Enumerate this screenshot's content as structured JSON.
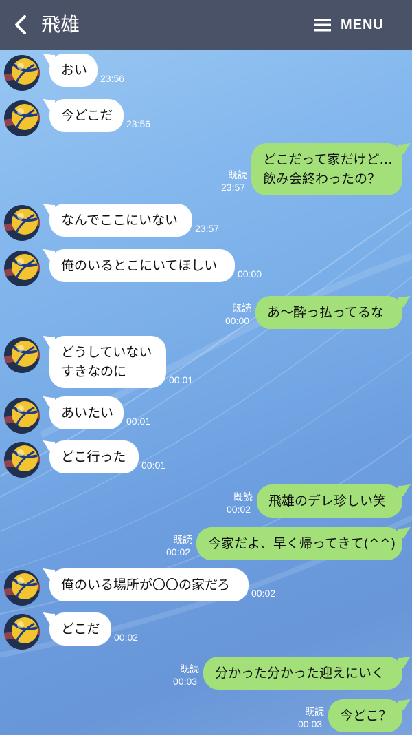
{
  "header": {
    "title": "飛雄",
    "menu_label": "MENU"
  },
  "messages": [
    {
      "side": "in",
      "lines": [
        "おい"
      ],
      "time": "23:56"
    },
    {
      "side": "in",
      "lines": [
        "今どこだ"
      ],
      "time": "23:56"
    },
    {
      "side": "out",
      "lines": [
        "どこだって家だけど…",
        "飲み会終わったの？"
      ],
      "time": "23:57",
      "read": "既読"
    },
    {
      "side": "in",
      "lines": [
        "なんでここにいない"
      ],
      "time": "23:57"
    },
    {
      "side": "in",
      "lines": [
        "俺のいるとこにいてほしい"
      ],
      "time": "00:00"
    },
    {
      "side": "out",
      "lines": [
        "あ〜酔っ払ってるな"
      ],
      "time": "00:00",
      "read": "既読"
    },
    {
      "side": "in",
      "lines": [
        "どうしていない",
        "すきなのに"
      ],
      "time": "00:01"
    },
    {
      "side": "in",
      "lines": [
        "あいたい"
      ],
      "time": "00:01"
    },
    {
      "side": "in",
      "lines": [
        "どこ行った"
      ],
      "time": "00:01"
    },
    {
      "side": "out",
      "lines": [
        "飛雄のデレ珍しい笑"
      ],
      "time": "00:02",
      "read": "既読"
    },
    {
      "side": "out",
      "lines": [
        "今家だよ、早く帰ってきて(^^)"
      ],
      "time": "00:02",
      "read": "既読"
    },
    {
      "side": "in",
      "lines": [
        "俺のいる場所が〇〇の家だろ"
      ],
      "time": "00:02"
    },
    {
      "side": "in",
      "lines": [
        "どこだ"
      ],
      "time": "00:02"
    },
    {
      "side": "out",
      "lines": [
        "分かった分かった迎えにいく"
      ],
      "time": "00:03",
      "read": "既読"
    },
    {
      "side": "out",
      "lines": [
        "今どこ？"
      ],
      "time": "00:03",
      "read": "既読"
    }
  ],
  "colors": {
    "header": "#4a5268",
    "bubble_in": "#ffffff",
    "bubble_out": "#a4e07a"
  },
  "icons": {
    "back": "chevron-left-icon",
    "menu": "hamburger-icon",
    "avatar": "volleyball-icon"
  }
}
